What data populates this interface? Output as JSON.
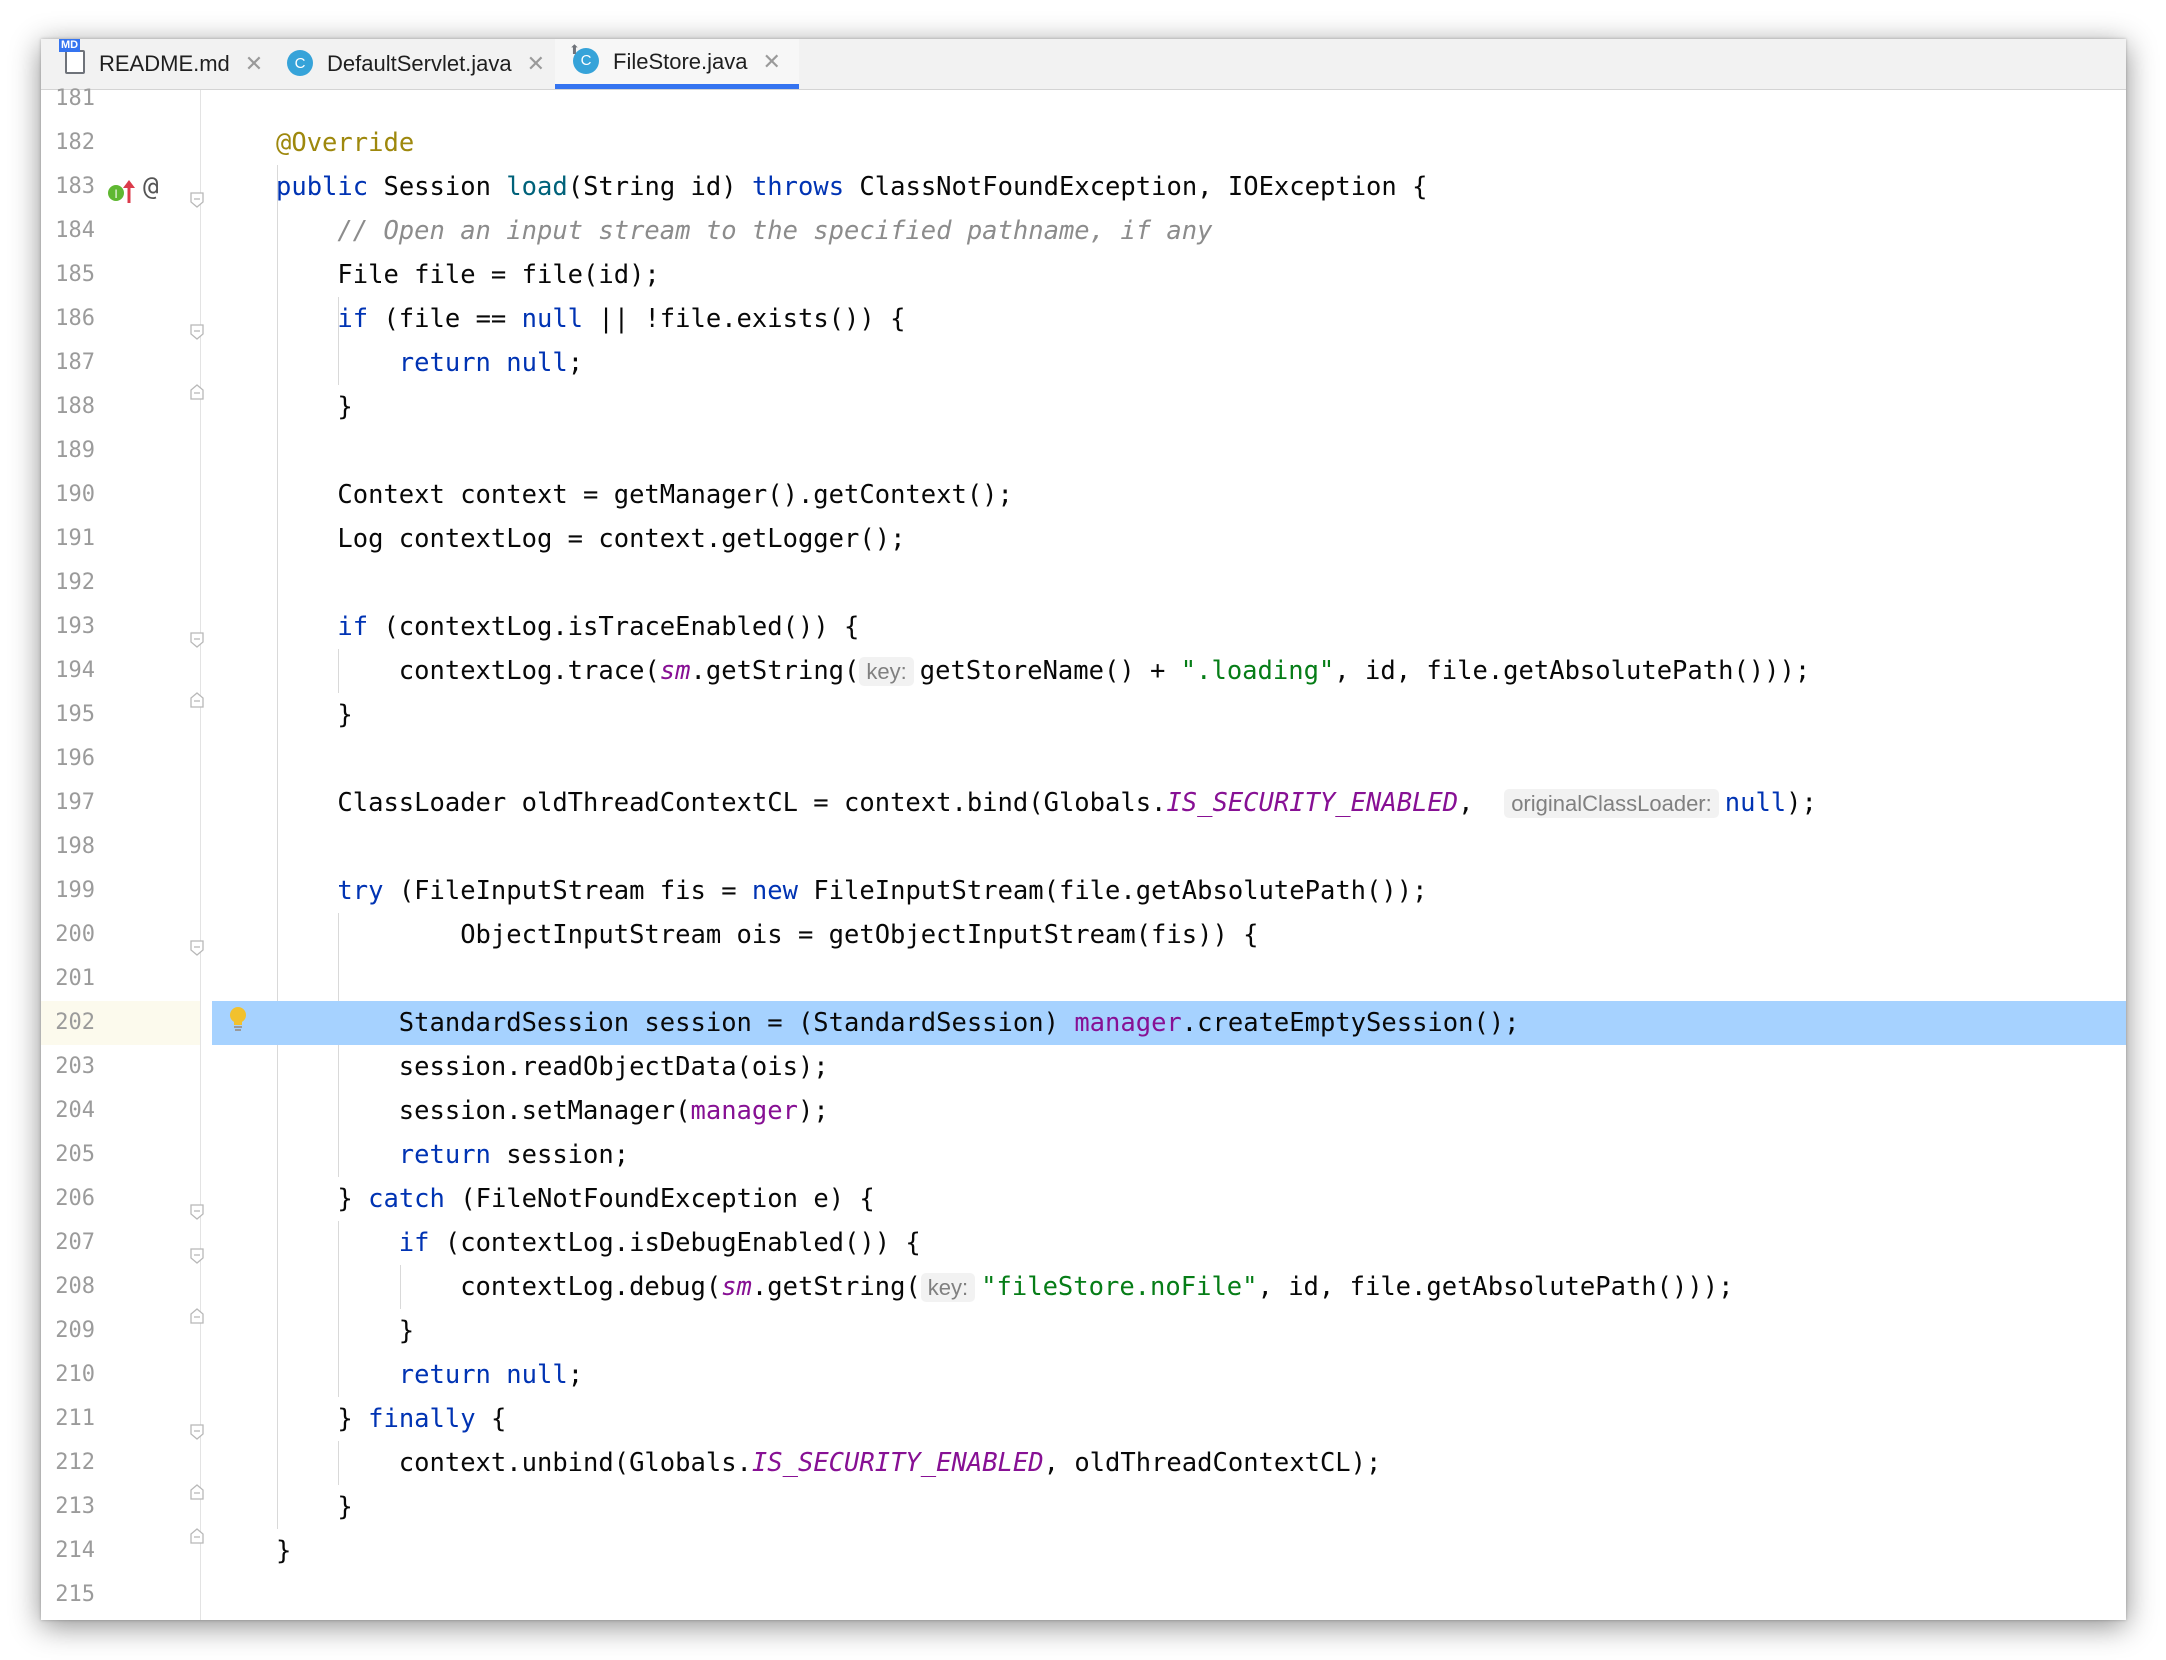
{
  "tabs": [
    {
      "label": "README.md",
      "icon": "markdown-file-icon",
      "icon_text": "MD",
      "active": false
    },
    {
      "label": "DefaultServlet.java",
      "icon": "java-class-icon",
      "icon_text": "C",
      "active": false
    },
    {
      "label": "FileStore.java",
      "icon": "java-class-icon",
      "icon_text": "C",
      "active": true
    }
  ],
  "close_glyph": "✕",
  "gutter_markers": {
    "override_icon": "implements-method-icon",
    "override_letter": "I",
    "annotation_icon": "at-sign-icon",
    "annotation_glyph": "@",
    "intention_icon": "lightbulb-icon"
  },
  "colors": {
    "keyword": "#0033b3",
    "annotation": "#9e880d",
    "comment": "#8c8c8c",
    "string": "#067d17",
    "field": "#871094",
    "selection": "#a6d2ff",
    "active_tab_underline": "#3574f0"
  },
  "current_line": "202",
  "lines": [
    {
      "num": "181",
      "indent": 0,
      "tokens": []
    },
    {
      "num": "182",
      "indent": 0,
      "tokens": [
        {
          "t": "@Override",
          "c": "an"
        }
      ]
    },
    {
      "num": "183",
      "indent": 0,
      "tokens": [
        {
          "t": "public ",
          "c": "kw"
        },
        {
          "t": "Session "
        },
        {
          "t": "load",
          "c": "fn"
        },
        {
          "t": "(String id) "
        },
        {
          "t": "throws ",
          "c": "kw"
        },
        {
          "t": "ClassNotFoundException, IOException {"
        }
      ]
    },
    {
      "num": "184",
      "indent": 1,
      "tokens": [
        {
          "t": "// Open an input stream to the specified pathname, if any",
          "c": "cm"
        }
      ]
    },
    {
      "num": "185",
      "indent": 1,
      "tokens": [
        {
          "t": "File file = file(id);"
        }
      ]
    },
    {
      "num": "186",
      "indent": 1,
      "tokens": [
        {
          "t": "if ",
          "c": "kw"
        },
        {
          "t": "(file == "
        },
        {
          "t": "null ",
          "c": "kw"
        },
        {
          "t": "|| !file.exists()) {"
        }
      ]
    },
    {
      "num": "187",
      "indent": 2,
      "tokens": [
        {
          "t": "return null",
          "c": "kw"
        },
        {
          "t": ";"
        }
      ]
    },
    {
      "num": "188",
      "indent": 1,
      "tokens": [
        {
          "t": "}"
        }
      ]
    },
    {
      "num": "189",
      "indent": 0,
      "tokens": []
    },
    {
      "num": "190",
      "indent": 1,
      "tokens": [
        {
          "t": "Context context = getManager().getContext();"
        }
      ]
    },
    {
      "num": "191",
      "indent": 1,
      "tokens": [
        {
          "t": "Log contextLog = context.getLogger();"
        }
      ]
    },
    {
      "num": "192",
      "indent": 0,
      "tokens": []
    },
    {
      "num": "193",
      "indent": 1,
      "tokens": [
        {
          "t": "if ",
          "c": "kw"
        },
        {
          "t": "(contextLog.isTraceEnabled()) {"
        }
      ]
    },
    {
      "num": "194",
      "indent": 2,
      "tokens": [
        {
          "t": "contextLog.trace("
        },
        {
          "t": "sm",
          "c": "sf"
        },
        {
          "t": ".getString("
        },
        {
          "t": "key:",
          "c": "hint"
        },
        {
          "t": "getStoreName() + "
        },
        {
          "t": "\".loading\"",
          "c": "st"
        },
        {
          "t": ", id, file.getAbsolutePath()));"
        }
      ]
    },
    {
      "num": "195",
      "indent": 1,
      "tokens": [
        {
          "t": "}"
        }
      ]
    },
    {
      "num": "196",
      "indent": 0,
      "tokens": []
    },
    {
      "num": "197",
      "indent": 1,
      "tokens": [
        {
          "t": "ClassLoader oldThreadContextCL = context.bind(Globals."
        },
        {
          "t": "IS_SECURITY_ENABLED",
          "c": "sf"
        },
        {
          "t": ",  "
        },
        {
          "t": "originalClassLoader:",
          "c": "hint"
        },
        {
          "t": "null",
          "c": "kw"
        },
        {
          "t": ");"
        }
      ]
    },
    {
      "num": "198",
      "indent": 0,
      "tokens": []
    },
    {
      "num": "199",
      "indent": 1,
      "tokens": [
        {
          "t": "try ",
          "c": "kw"
        },
        {
          "t": "(FileInputStream fis = "
        },
        {
          "t": "new ",
          "c": "kw"
        },
        {
          "t": "FileInputStream(file.getAbsolutePath());"
        }
      ]
    },
    {
      "num": "200",
      "indent": 3,
      "tokens": [
        {
          "t": "ObjectInputStream ois = getObjectInputStream(fis)) {"
        }
      ]
    },
    {
      "num": "201",
      "indent": 0,
      "tokens": []
    },
    {
      "num": "202",
      "indent": 2,
      "tokens": [
        {
          "t": "StandardSession session = (StandardSession) "
        },
        {
          "t": "manager",
          "c": "fd"
        },
        {
          "t": ".createEmptySession();"
        }
      ]
    },
    {
      "num": "203",
      "indent": 2,
      "tokens": [
        {
          "t": "session.readObjectData(ois);"
        }
      ]
    },
    {
      "num": "204",
      "indent": 2,
      "tokens": [
        {
          "t": "session.setManager("
        },
        {
          "t": "manager",
          "c": "fd"
        },
        {
          "t": ");"
        }
      ]
    },
    {
      "num": "205",
      "indent": 2,
      "tokens": [
        {
          "t": "return ",
          "c": "kw"
        },
        {
          "t": "session;"
        }
      ]
    },
    {
      "num": "206",
      "indent": 1,
      "tokens": [
        {
          "t": "} "
        },
        {
          "t": "catch ",
          "c": "kw"
        },
        {
          "t": "(FileNotFoundException e) {"
        }
      ]
    },
    {
      "num": "207",
      "indent": 2,
      "tokens": [
        {
          "t": "if ",
          "c": "kw"
        },
        {
          "t": "(contextLog.isDebugEnabled()) {"
        }
      ]
    },
    {
      "num": "208",
      "indent": 3,
      "tokens": [
        {
          "t": "contextLog.debug("
        },
        {
          "t": "sm",
          "c": "sf"
        },
        {
          "t": ".getString("
        },
        {
          "t": "key:",
          "c": "hint"
        },
        {
          "t": "\"fileStore.noFile\"",
          "c": "st"
        },
        {
          "t": ", id, file.getAbsolutePath()));"
        }
      ]
    },
    {
      "num": "209",
      "indent": 2,
      "tokens": [
        {
          "t": "}"
        }
      ]
    },
    {
      "num": "210",
      "indent": 2,
      "tokens": [
        {
          "t": "return null",
          "c": "kw"
        },
        {
          "t": ";"
        }
      ]
    },
    {
      "num": "211",
      "indent": 1,
      "tokens": [
        {
          "t": "} "
        },
        {
          "t": "finally ",
          "c": "kw"
        },
        {
          "t": "{"
        }
      ]
    },
    {
      "num": "212",
      "indent": 2,
      "tokens": [
        {
          "t": "context.unbind(Globals."
        },
        {
          "t": "IS_SECURITY_ENABLED",
          "c": "sf"
        },
        {
          "t": ", oldThreadContextCL);"
        }
      ]
    },
    {
      "num": "213",
      "indent": 1,
      "tokens": [
        {
          "t": "}"
        }
      ]
    },
    {
      "num": "214",
      "indent": 0,
      "tokens": [
        {
          "t": "}"
        }
      ]
    },
    {
      "num": "215",
      "indent": 0,
      "tokens": []
    }
  ]
}
